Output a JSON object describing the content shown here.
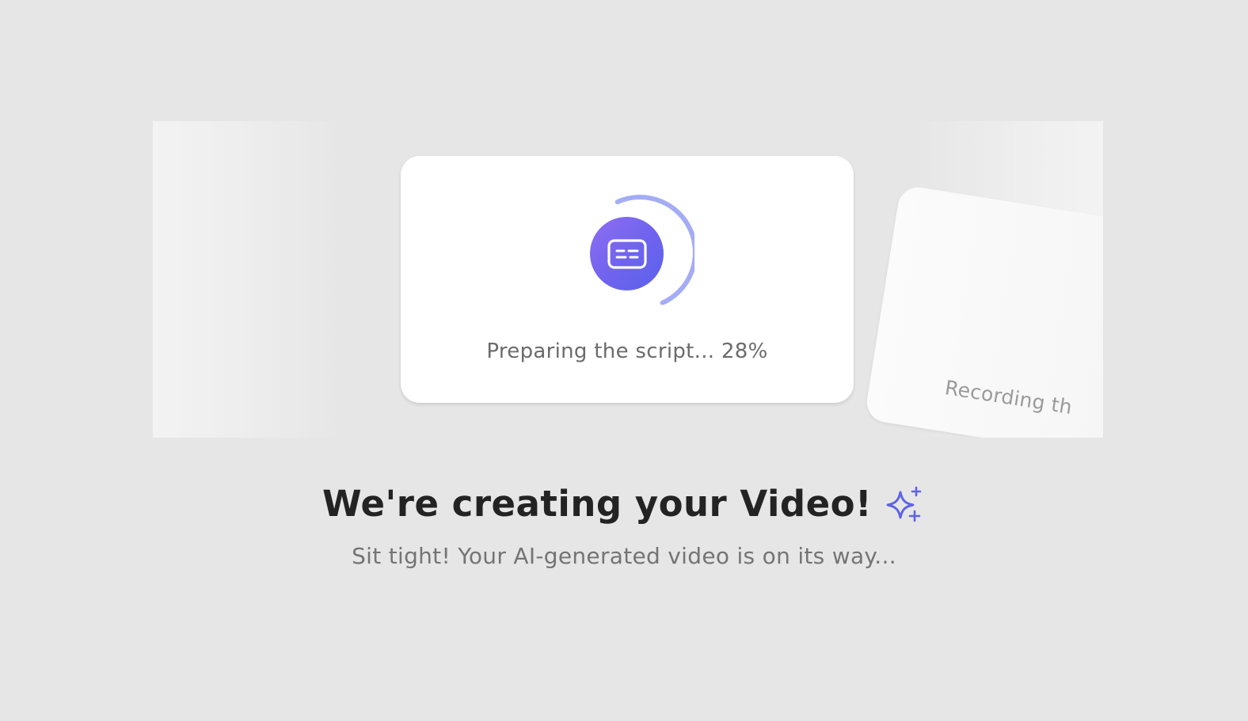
{
  "progress": {
    "status_text": "Preparing the script... 28%",
    "percent": 28,
    "icon": "subtitles-icon"
  },
  "next_step": {
    "status_text": "Recording th",
    "icon": "microphone-icon"
  },
  "heading": {
    "title": "We're creating your Video!",
    "icon": "sparkles-icon"
  },
  "subtitle": "Sit tight! Your AI-generated video is on its way...",
  "colors": {
    "background": "#e6e6e6",
    "accent": "#6e63ee",
    "accent_light": "#9fa7f2",
    "heading": "#232323",
    "subtext": "#747474"
  }
}
